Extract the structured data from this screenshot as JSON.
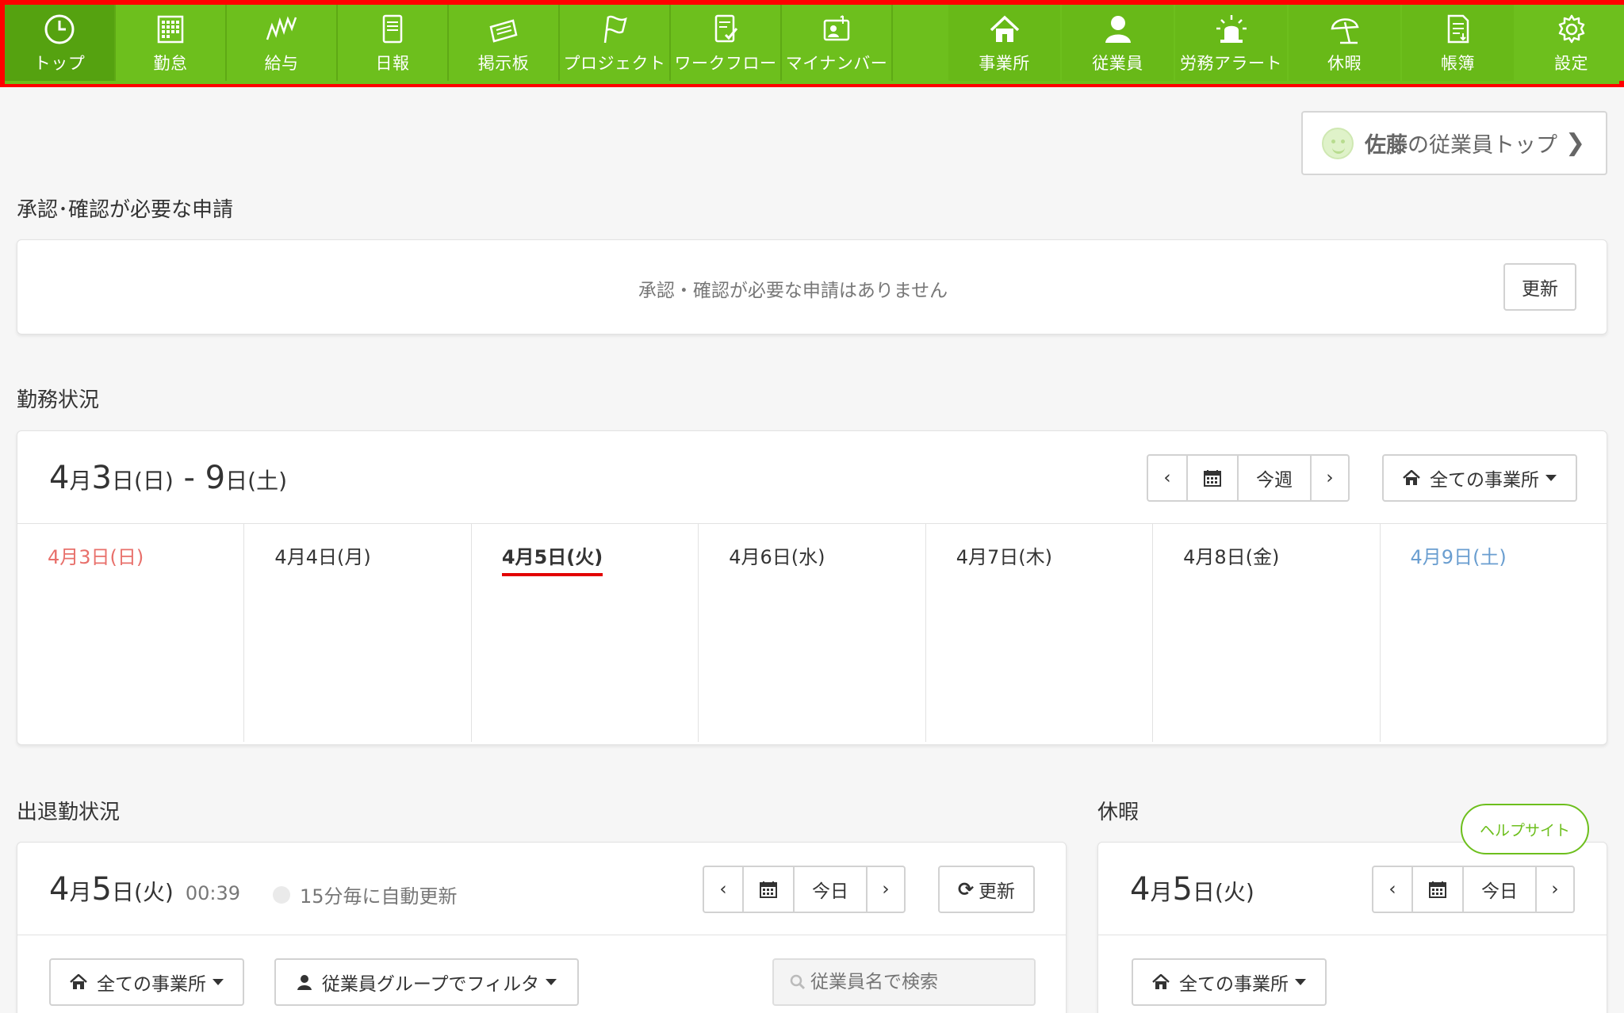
{
  "nav": {
    "left": [
      {
        "label": "トップ",
        "icon": "clock-icon"
      },
      {
        "label": "勤怠",
        "icon": "grid-calendar-icon"
      },
      {
        "label": "給与",
        "icon": "zigzag-chart-icon"
      },
      {
        "label": "日報",
        "icon": "notebook-icon"
      },
      {
        "label": "掲示板",
        "icon": "message-board-icon"
      },
      {
        "label": "プロジェクト",
        "icon": "flag-icon"
      },
      {
        "label": "ワークフロー",
        "icon": "checklist-icon"
      },
      {
        "label": "マイナンバー",
        "icon": "id-card-icon"
      }
    ],
    "right": [
      {
        "label": "事業所",
        "icon": "home-icon"
      },
      {
        "label": "従業員",
        "icon": "person-icon"
      },
      {
        "label": "労務アラート",
        "icon": "alarm-light-icon"
      },
      {
        "label": "休暇",
        "icon": "beach-umbrella-icon"
      },
      {
        "label": "帳簿",
        "icon": "ledger-icon"
      },
      {
        "label": "設定",
        "icon": "gear-icon"
      }
    ]
  },
  "employee_top": {
    "name": "佐藤",
    "rest": "の従業員トップ"
  },
  "approval": {
    "title": "承認･確認が必要な申請",
    "empty_message": "承認・確認が必要な申請はありません",
    "refresh_label": "更新"
  },
  "work_status": {
    "title": "勤務状況",
    "range": {
      "m1": "4",
      "mu": "月",
      "d1": "3",
      "du1": "日",
      "w1": "(日)",
      "dash": " - ",
      "d2": "9",
      "du2": "日",
      "w2": "(土)"
    },
    "this_week_label": "今週",
    "office_filter": "全ての事業所",
    "days": [
      {
        "label": "4月3日(日)",
        "kind": "sun"
      },
      {
        "label": "4月4日(月)",
        "kind": ""
      },
      {
        "label": "4月5日(火)",
        "kind": "today"
      },
      {
        "label": "4月6日(水)",
        "kind": ""
      },
      {
        "label": "4月7日(木)",
        "kind": ""
      },
      {
        "label": "4月8日(金)",
        "kind": ""
      },
      {
        "label": "4月9日(土)",
        "kind": "sat"
      }
    ]
  },
  "attendance": {
    "title": "出退勤状況",
    "date": {
      "m": "4",
      "mu": "月",
      "d": "5",
      "du": "日",
      "w": "(火)"
    },
    "time": "00:39",
    "auto_refresh": "15分毎に自動更新",
    "today_label": "今日",
    "refresh_label": "更新",
    "office_filter": "全ての事業所",
    "group_filter": "従業員グループでフィルタ",
    "search_placeholder": "従業員名で検索"
  },
  "leave": {
    "title": "休暇",
    "date": {
      "m": "4",
      "mu": "月",
      "d": "5",
      "du": "日",
      "w": "(火)"
    },
    "today_label": "今日",
    "office_filter": "全ての事業所"
  },
  "help_label": "ヘルプサイト",
  "colors": {
    "brand_green": "#6dbf1d",
    "highlight_border": "#ff0000",
    "sunday": "#e8706b",
    "saturday": "#6a9ed0",
    "today_underline": "#e20000"
  }
}
